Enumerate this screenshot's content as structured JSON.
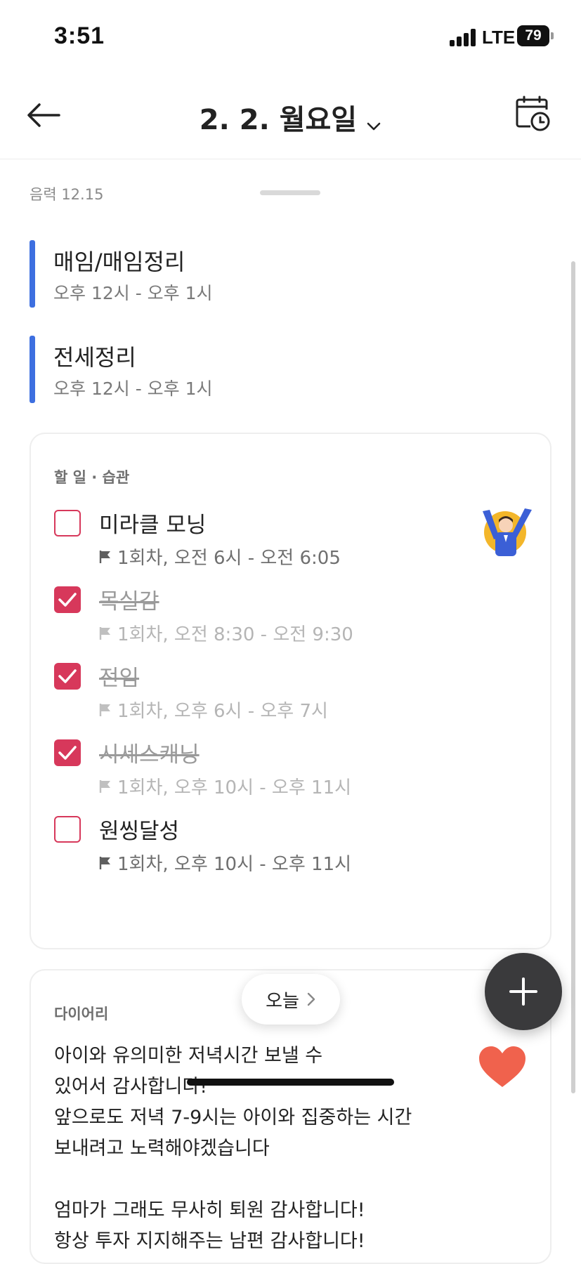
{
  "status_bar": {
    "time": "3:51",
    "network": "LTE",
    "battery": "79"
  },
  "header": {
    "title": "2. 2. 월요일"
  },
  "lunar_date": "음력 12.15",
  "events": [
    {
      "title": "매임/매임정리",
      "time": "오후 12시 - 오후 1시",
      "color": "#3d6fe0"
    },
    {
      "title": "전세정리",
      "time": "오후 12시 - 오후 1시",
      "color": "#3d6fe0"
    }
  ],
  "tasks_section": {
    "label": "할 일 · 습관",
    "items": [
      {
        "title": "미라클 모닝",
        "meta": "1회차, 오전 6시 - 오전 6:05",
        "done": false
      },
      {
        "title": "목실감",
        "meta": "1회차, 오전 8:30 - 오전 9:30",
        "done": true
      },
      {
        "title": "전임",
        "meta": "1회차, 오후 6시 - 오후 7시",
        "done": true
      },
      {
        "title": "시세스캐닝",
        "meta": "1회차, 오후 10시 - 오후 11시",
        "done": true
      },
      {
        "title": "원씽달성",
        "meta": "1회차, 오후 10시 - 오후 11시",
        "done": false
      }
    ]
  },
  "diary_section": {
    "label": "다이어리",
    "text": "아이와 유의미한 저녁시간 보낼 수\n있어서 감사합니다!\n앞으로도 저녁 7-9시는 아이와 집중하는 시간\n보내려고 노력해야겠습니다\n\n엄마가 그래도 무사히 퇴원 감사합니다!\n항상 투자 지지해주는 남편 감사합니다!"
  },
  "today_button": {
    "label": "오늘"
  },
  "colors": {
    "accent_check": "#d7385b",
    "event_bar": "#3d6fe0",
    "heart": "#f0624d",
    "fab": "#3a3a3c"
  }
}
